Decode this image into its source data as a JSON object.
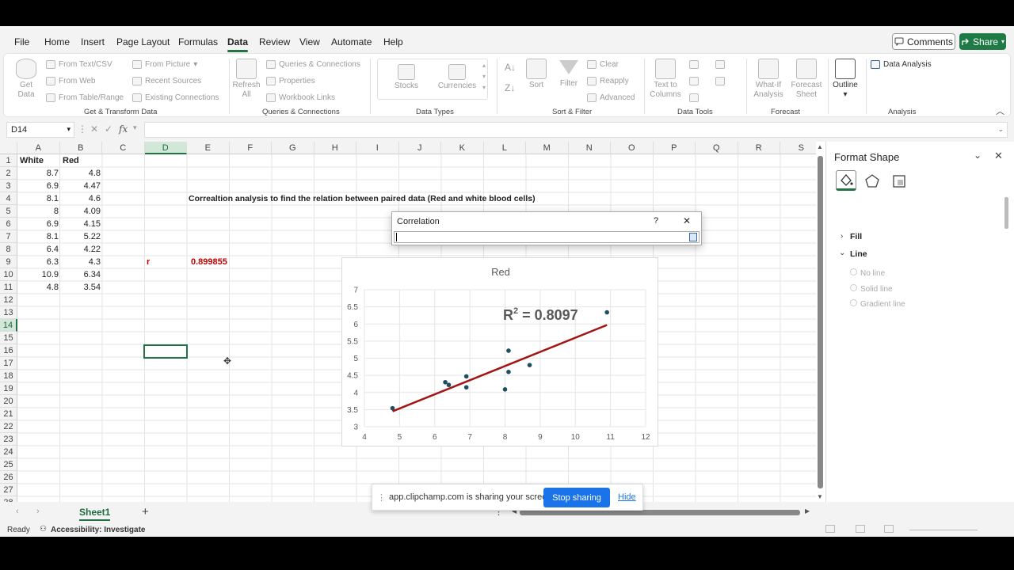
{
  "menu": {
    "items": [
      "File",
      "Home",
      "Insert",
      "Page Layout",
      "Formulas",
      "Data",
      "Review",
      "View",
      "Automate",
      "Help"
    ],
    "active": "Data",
    "comments_label": "Comments",
    "share_label": "Share"
  },
  "ribbon": {
    "get_transform": {
      "get_data": "Get Data",
      "from_text_csv": "From Text/CSV",
      "from_web": "From Web",
      "from_table_range": "From Table/Range",
      "from_picture": "From Picture",
      "recent_sources": "Recent Sources",
      "existing_connections": "Existing Connections",
      "label": "Get & Transform Data"
    },
    "queries": {
      "refresh_all": "Refresh All",
      "queries_connections": "Queries & Connections",
      "properties": "Properties",
      "workbook_links": "Workbook Links",
      "label": "Queries & Connections"
    },
    "data_types": {
      "stocks": "Stocks",
      "currencies": "Currencies",
      "label": "Data Types"
    },
    "sort_filter": {
      "sort": "Sort",
      "filter": "Filter",
      "clear": "Clear",
      "reapply": "Reapply",
      "advanced": "Advanced",
      "label": "Sort & Filter"
    },
    "data_tools": {
      "text_to_columns": "Text to Columns",
      "label": "Data Tools"
    },
    "forecast": {
      "what_if": "What-If Analysis",
      "forecast_sheet": "Forecast Sheet",
      "label": "Forecast"
    },
    "outline": {
      "label": "Outline"
    },
    "analysis": {
      "data_analysis": "Data Analysis",
      "label": "Analysis"
    }
  },
  "formula_bar": {
    "name_box": "D14",
    "fx": "fx",
    "value": ""
  },
  "columns": [
    "A",
    "B",
    "C",
    "D",
    "E",
    "F",
    "G",
    "H",
    "I",
    "J",
    "K",
    "L",
    "M",
    "N",
    "O",
    "P",
    "Q",
    "R",
    "S"
  ],
  "rows": [
    "1",
    "2",
    "3",
    "4",
    "5",
    "6",
    "7",
    "8",
    "9",
    "10",
    "11",
    "12",
    "13",
    "14",
    "15",
    "16",
    "17",
    "18",
    "19",
    "20",
    "21",
    "22",
    "23",
    "24",
    "25",
    "26",
    "27",
    "28"
  ],
  "cells": {
    "a1": "White",
    "b1": "Red",
    "white": [
      "8.7",
      "6.9",
      "8.1",
      "8",
      "6.9",
      "8.1",
      "6.4",
      "6.3",
      "10.9",
      "4.8"
    ],
    "red": [
      "4.8",
      "4.47",
      "4.6",
      "4.09",
      "4.15",
      "5.22",
      "4.22",
      "4.3",
      "6.34",
      "3.54"
    ],
    "d4_title": "Correaltion analysis to find the relation between paired data (Red and white blood cells)",
    "d9_label": "r",
    "e9_value": "0.899855"
  },
  "chart_data": {
    "type": "scatter",
    "title": "Red",
    "x": [
      8.7,
      6.9,
      8.1,
      8,
      6.9,
      8.1,
      6.4,
      6.3,
      10.9,
      4.8
    ],
    "y": [
      4.8,
      4.47,
      4.6,
      4.09,
      4.15,
      5.22,
      4.22,
      4.3,
      6.34,
      3.54
    ],
    "xlim": [
      4,
      12
    ],
    "ylim": [
      3,
      7
    ],
    "xticks": [
      "4",
      "5",
      "6",
      "7",
      "8",
      "9",
      "10",
      "11",
      "12"
    ],
    "yticks": [
      "3",
      "3.5",
      "4",
      "4.5",
      "5",
      "5.5",
      "6",
      "6.5",
      "7"
    ],
    "trendline": {
      "x": [
        4.8,
        10.9
      ],
      "y": [
        3.45,
        5.97
      ]
    },
    "r2_label": "R",
    "r2_sup": "2",
    "r2_value": " = 0.8097",
    "grid": true,
    "colors": {
      "points": "#1f4e5f",
      "trendline": "#a31515"
    }
  },
  "dialog": {
    "title": "Correlation",
    "help": "?",
    "close": "✕"
  },
  "format_pane": {
    "title": "Format Shape",
    "fill_label": "Fill",
    "line_label": "Line",
    "options": [
      "No line",
      "Solid line",
      "Gradient line"
    ]
  },
  "tabs": {
    "sheet1": "Sheet1",
    "add": "+"
  },
  "status": {
    "ready": "Ready",
    "accessibility": "Accessibility: Investigate"
  },
  "share_bar": {
    "message": "app.clipchamp.com is sharing your screen.",
    "stop_label": "Stop sharing",
    "hide_label": "Hide"
  },
  "colors": {
    "accent": "#217346",
    "red_text": "#c00000",
    "stop_blue": "#1a73e8"
  }
}
